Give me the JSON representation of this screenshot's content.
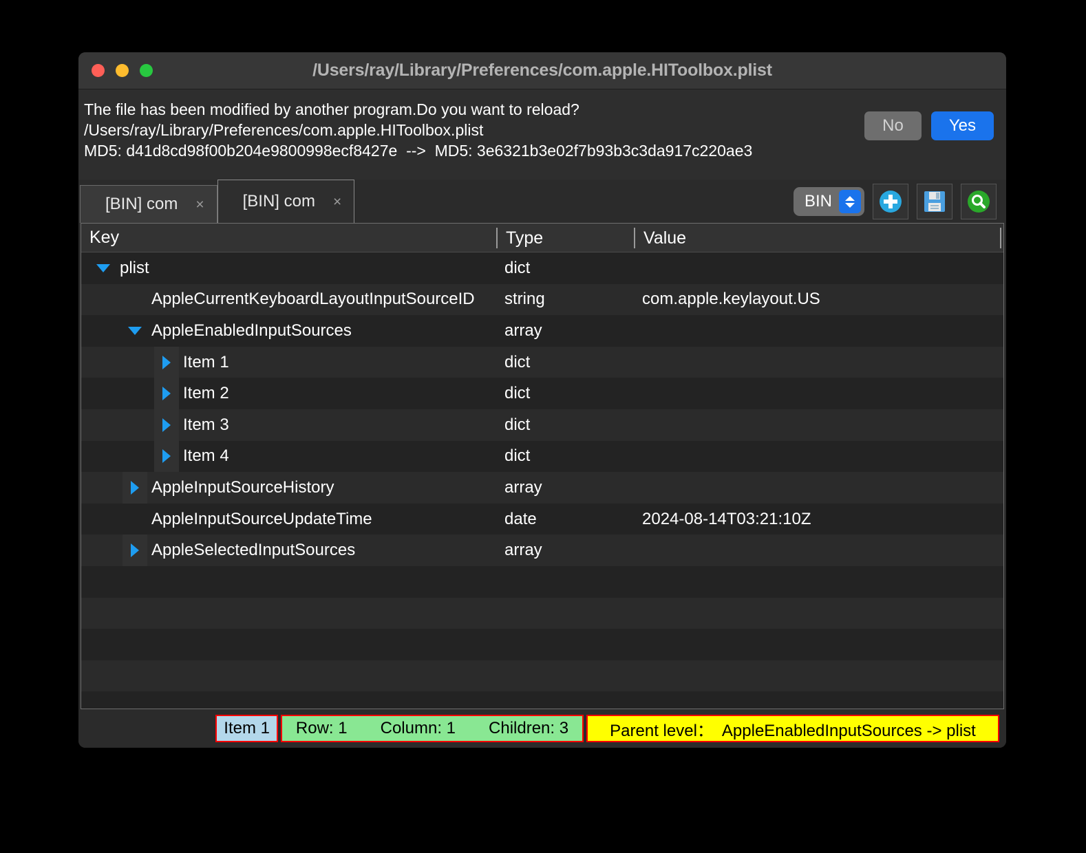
{
  "window": {
    "title": "/Users/ray/Library/Preferences/com.apple.HIToolbox.plist",
    "traffic_lights": {
      "close": "close-button",
      "minimize": "minimize-button",
      "zoom": "zoom-button"
    }
  },
  "alert": {
    "line1": "The file has been modified by another program.Do you want to reload?",
    "line2": "/Users/ray/Library/Preferences/com.apple.HIToolbox.plist",
    "line3": "MD5: d41d8cd98f00b204e9800998ecf8427e  -->  MD5: 3e6321b3e02f7b93b3c3da917c220ae3",
    "no_label": "No",
    "yes_label": "Yes"
  },
  "tabs": [
    {
      "label": "[BIN] com",
      "close": "×",
      "active": false
    },
    {
      "label": "[BIN] com",
      "close": "×",
      "active": true
    }
  ],
  "toolbar": {
    "format_value": "BIN",
    "add_icon": "plus-icon",
    "save_icon": "floppy-save-icon",
    "search_icon": "magnifier-icon"
  },
  "table": {
    "headers": {
      "key": "Key",
      "type": "Type",
      "value": "Value"
    },
    "rows": [
      {
        "indent": 0,
        "disclosure": "down",
        "key": "plist",
        "type": "dict",
        "value": ""
      },
      {
        "indent": 1,
        "disclosure": "none",
        "key": "AppleCurrentKeyboardLayoutInputSourceID",
        "type": "string",
        "value": "com.apple.keylayout.US"
      },
      {
        "indent": 1,
        "disclosure": "down",
        "key": "AppleEnabledInputSources",
        "type": "array",
        "value": ""
      },
      {
        "indent": 2,
        "disclosure": "right",
        "key": "Item 1",
        "type": "dict",
        "value": ""
      },
      {
        "indent": 2,
        "disclosure": "right",
        "key": "Item 2",
        "type": "dict",
        "value": ""
      },
      {
        "indent": 2,
        "disclosure": "right",
        "key": "Item 3",
        "type": "dict",
        "value": ""
      },
      {
        "indent": 2,
        "disclosure": "right",
        "key": "Item 4",
        "type": "dict",
        "value": ""
      },
      {
        "indent": 1,
        "disclosure": "right",
        "key": "AppleInputSourceHistory",
        "type": "array",
        "value": ""
      },
      {
        "indent": 1,
        "disclosure": "none",
        "key": "AppleInputSourceUpdateTime",
        "type": "date",
        "value": "2024-08-14T03:21:10Z"
      },
      {
        "indent": 1,
        "disclosure": "right",
        "key": "AppleSelectedInputSources",
        "type": "array",
        "value": ""
      }
    ],
    "empty_rows": 5
  },
  "statusbar": {
    "selected_item": "Item 1",
    "row": "Row: 1",
    "column": "Column: 1",
    "children": "Children: 3",
    "parent_level": "Parent level：  AppleEnabledInputSources -> plist"
  },
  "colors": {
    "accent_blue": "#1a73ec",
    "disclosure_blue": "#1e9df1",
    "status_item_bg": "#b3d7ea",
    "status_rcc_bg": "#89e793",
    "status_parent_bg": "#ffff00",
    "status_border": "#ff0000",
    "traffic_red": "#ff5f57",
    "traffic_yellow": "#febc2e",
    "traffic_green": "#28c840",
    "save_icon_blue": "#4a9fe0",
    "search_icon_green": "#2aa82a"
  }
}
